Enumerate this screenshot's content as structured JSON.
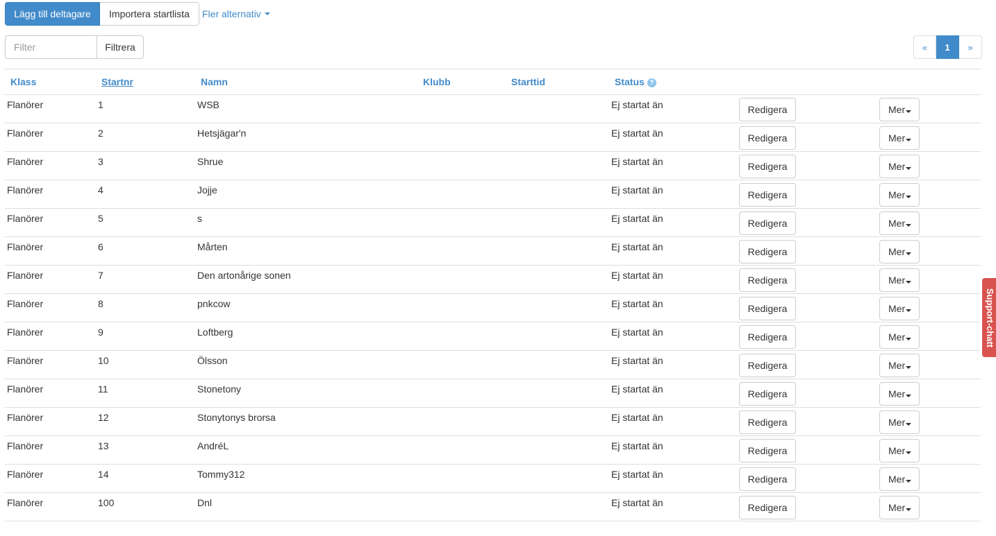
{
  "toolbar": {
    "add_label": "Lägg till deltagare",
    "import_label": "Importera startlista",
    "more_label": "Fler alternativ"
  },
  "filter": {
    "placeholder": "Filter",
    "button_label": "Filtrera"
  },
  "pagination": {
    "prev": "«",
    "current": "1",
    "next": "»"
  },
  "table": {
    "headers": {
      "klass": "Klass",
      "startnr": "Startnr",
      "namn": "Namn",
      "klubb": "Klubb",
      "starttid": "Starttid",
      "status": "Status"
    },
    "edit_label": "Redigera",
    "more_label": "Mer",
    "rows": [
      {
        "klass": "Flanörer",
        "startnr": "1",
        "namn": "WSB",
        "klubb": "",
        "starttid": "",
        "status": "Ej startat än"
      },
      {
        "klass": "Flanörer",
        "startnr": "2",
        "namn": "Hetsjägar'n",
        "klubb": "",
        "starttid": "",
        "status": "Ej startat än"
      },
      {
        "klass": "Flanörer",
        "startnr": "3",
        "namn": "Shrue",
        "klubb": "",
        "starttid": "",
        "status": "Ej startat än"
      },
      {
        "klass": "Flanörer",
        "startnr": "4",
        "namn": "Jojje",
        "klubb": "",
        "starttid": "",
        "status": "Ej startat än"
      },
      {
        "klass": "Flanörer",
        "startnr": "5",
        "namn": "s",
        "klubb": "",
        "starttid": "",
        "status": "Ej startat än"
      },
      {
        "klass": "Flanörer",
        "startnr": "6",
        "namn": "Mårten",
        "klubb": "",
        "starttid": "",
        "status": "Ej startat än"
      },
      {
        "klass": "Flanörer",
        "startnr": "7",
        "namn": "Den artonårige sonen",
        "klubb": "",
        "starttid": "",
        "status": "Ej startat än"
      },
      {
        "klass": "Flanörer",
        "startnr": "8",
        "namn": "pnkcow",
        "klubb": "",
        "starttid": "",
        "status": "Ej startat än"
      },
      {
        "klass": "Flanörer",
        "startnr": "9",
        "namn": "Loftberg",
        "klubb": "",
        "starttid": "",
        "status": "Ej startat än"
      },
      {
        "klass": "Flanörer",
        "startnr": "10",
        "namn": "Ölsson",
        "klubb": "",
        "starttid": "",
        "status": "Ej startat än"
      },
      {
        "klass": "Flanörer",
        "startnr": "11",
        "namn": "Stonetony",
        "klubb": "",
        "starttid": "",
        "status": "Ej startat än"
      },
      {
        "klass": "Flanörer",
        "startnr": "12",
        "namn": "Stonytonys brorsa",
        "klubb": "",
        "starttid": "",
        "status": "Ej startat än"
      },
      {
        "klass": "Flanörer",
        "startnr": "13",
        "namn": "AndréL",
        "klubb": "",
        "starttid": "",
        "status": "Ej startat än"
      },
      {
        "klass": "Flanörer",
        "startnr": "14",
        "namn": "Tommy312",
        "klubb": "",
        "starttid": "",
        "status": "Ej startat än"
      },
      {
        "klass": "Flanörer",
        "startnr": "100",
        "namn": "Dnl",
        "klubb": "",
        "starttid": "",
        "status": "Ej startat än"
      }
    ]
  },
  "support": {
    "label": "Support-chatt"
  },
  "colors": {
    "primary": "#428bca",
    "support": "#d9534f",
    "border": "#dddddd"
  },
  "icons": {
    "status_help": "question-circle-icon",
    "dropdown": "caret-down-icon"
  }
}
